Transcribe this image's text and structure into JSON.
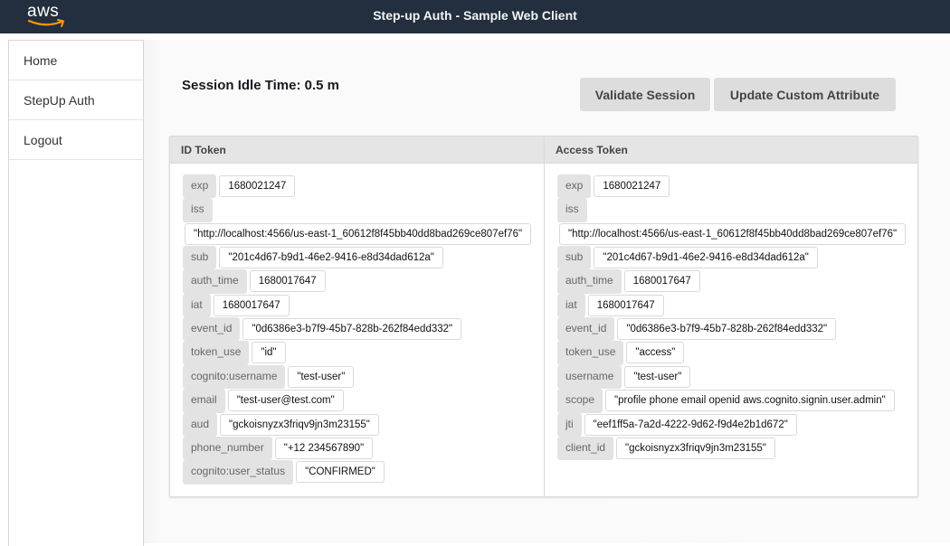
{
  "header": {
    "logo_text": "aws",
    "title": "Step-up Auth - Sample Web Client",
    "brand_accent": "#ff9900",
    "bar_color": "#232f3e"
  },
  "sidebar": {
    "items": [
      {
        "label": "Home"
      },
      {
        "label": "StepUp Auth"
      },
      {
        "label": "Logout"
      }
    ]
  },
  "main": {
    "session_idle": "Session Idle Time: 0.5 m",
    "buttons": {
      "validate": "Validate Session",
      "update": "Update Custom Attribute"
    }
  },
  "id_token": {
    "title": "ID Token",
    "claims": [
      {
        "key": "exp",
        "value": "1680021247"
      },
      {
        "key": "iss",
        "value": "\"http://localhost:4566/us-east-1_60612f8f45bb40dd8bad269ce807ef76\""
      },
      {
        "key": "sub",
        "value": "\"201c4d67-b9d1-46e2-9416-e8d34dad612a\""
      },
      {
        "key": "auth_time",
        "value": "1680017647"
      },
      {
        "key": "iat",
        "value": "1680017647"
      },
      {
        "key": "event_id",
        "value": "\"0d6386e3-b7f9-45b7-828b-262f84edd332\""
      },
      {
        "key": "token_use",
        "value": "\"id\""
      },
      {
        "key": "cognito:username",
        "value": "\"test-user\""
      },
      {
        "key": "email",
        "value": "\"test-user@test.com\""
      },
      {
        "key": "aud",
        "value": "\"gckoisnyzx3friqv9jn3m23155\""
      },
      {
        "key": "phone_number",
        "value": "\"+12 234567890\""
      },
      {
        "key": "cognito:user_status",
        "value": "\"CONFIRMED\""
      }
    ]
  },
  "access_token": {
    "title": "Access Token",
    "claims": [
      {
        "key": "exp",
        "value": "1680021247"
      },
      {
        "key": "iss",
        "value": "\"http://localhost:4566/us-east-1_60612f8f45bb40dd8bad269ce807ef76\""
      },
      {
        "key": "sub",
        "value": "\"201c4d67-b9d1-46e2-9416-e8d34dad612a\""
      },
      {
        "key": "auth_time",
        "value": "1680017647"
      },
      {
        "key": "iat",
        "value": "1680017647"
      },
      {
        "key": "event_id",
        "value": "\"0d6386e3-b7f9-45b7-828b-262f84edd332\""
      },
      {
        "key": "token_use",
        "value": "\"access\""
      },
      {
        "key": "username",
        "value": "\"test-user\""
      },
      {
        "key": "scope",
        "value": "\"profile phone email openid aws.cognito.signin.user.admin\""
      },
      {
        "key": "jti",
        "value": "\"eef1ff5a-7a2d-4222-9d62-f9d4e2b1d672\""
      },
      {
        "key": "client_id",
        "value": "\"gckoisnyzx3friqv9jn3m23155\""
      }
    ]
  }
}
